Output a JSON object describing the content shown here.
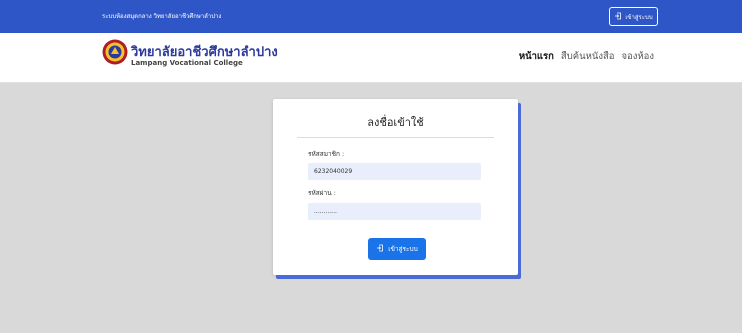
{
  "topbar": {
    "title": "ระบบห้องสมุดกลาง วิทยาลัยอาชีวศึกษาลำปาง",
    "login_label": "เข้าสู่ระบบ",
    "login_icon": "login-icon"
  },
  "header": {
    "brand_th": "วิทยาลัยอาชีวศึกษาลำปาง",
    "brand_en": "Lampang Vocational College",
    "nav": [
      {
        "label": "หน้าแรก",
        "active": true
      },
      {
        "label": "สืบค้นหนังสือ",
        "active": false
      },
      {
        "label": "จองห้อง",
        "active": false
      }
    ]
  },
  "login_card": {
    "title": "ลงชื่อเข้าใช้",
    "member_id_label": "รหัสสมาชิก :",
    "member_id_value": "6232040029",
    "password_label": "รหัสผ่าน :",
    "password_value": "............",
    "submit_label": "เข้าสู่ระบบ",
    "submit_icon": "login-icon"
  },
  "colors": {
    "topbar": "#2e56c7",
    "brand": "#2d3a9c",
    "button": "#1a73e8",
    "background": "#d9d9d9",
    "input": "#e8eefb"
  }
}
